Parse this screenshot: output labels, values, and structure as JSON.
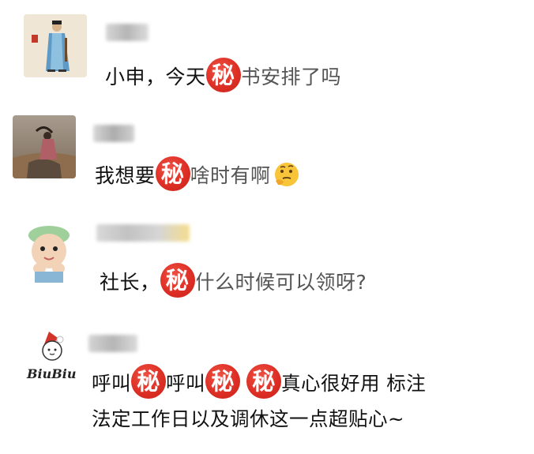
{
  "messages": [
    {
      "avatar": "ancient-robed-figure-avatar",
      "before": "小申，今天",
      "stamp": "秘",
      "after": "书安排了吗"
    },
    {
      "avatar": "desert-woman-avatar",
      "before": "我想要",
      "stamp": "秘",
      "after": "啥时有啊",
      "emoji": "thinking-face-emoji"
    },
    {
      "avatar": "baby-face-avatar",
      "before": "社长，",
      "stamp": "秘",
      "after": "什么时候可以领呀?"
    },
    {
      "avatar": "biubiu-cat-avatar",
      "avatar_text": "BiuBiu",
      "line1": [
        "呼叫",
        "秘",
        "呼叫",
        "秘",
        "",
        "秘",
        "真心很好用 标注"
      ],
      "line2": "法定工作日以及调休这一点超贴心~"
    }
  ],
  "colors": {
    "stamp_red": "#dd2f25",
    "text": "#111111"
  }
}
